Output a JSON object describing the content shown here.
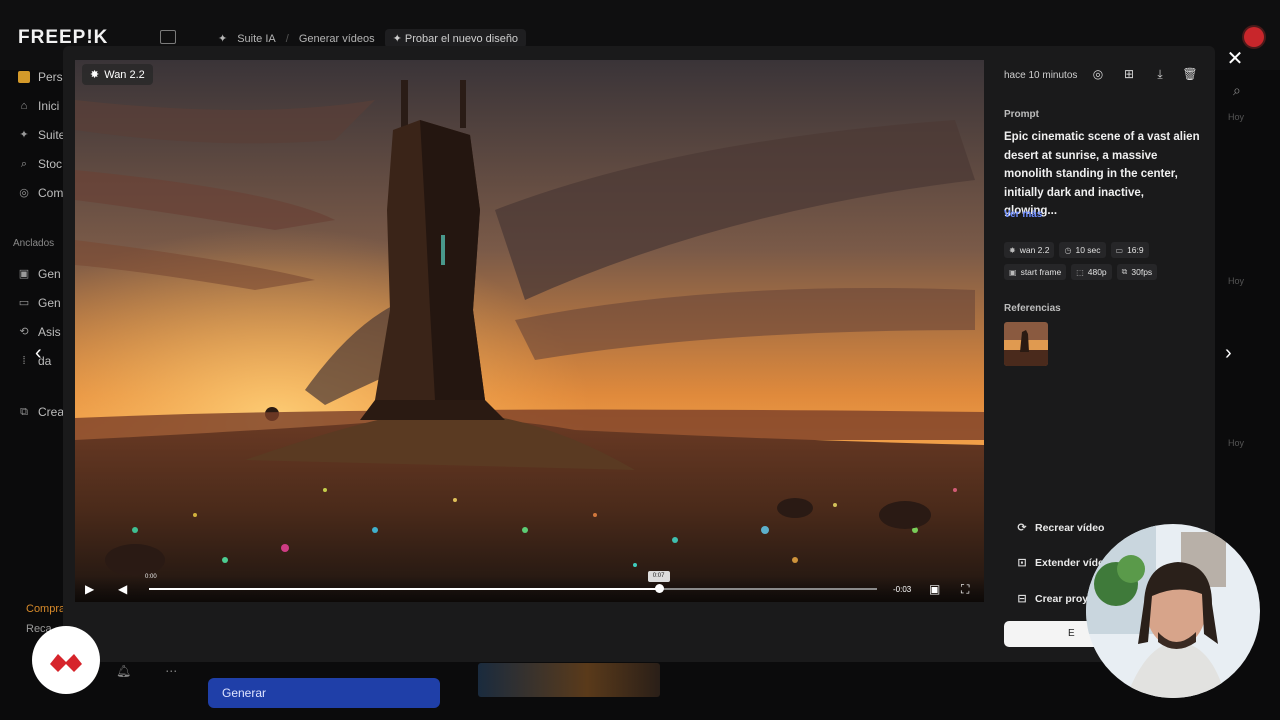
{
  "app": {
    "logo": "FREEP!K",
    "breadcrumbs": [
      "Suite IA",
      "Generar vídeos"
    ],
    "new_design_label": "Probar el nuevo diseño"
  },
  "sidebar": {
    "items": [
      {
        "label": "Pers",
        "icon": "folder-icon"
      },
      {
        "label": "Inici",
        "icon": "home-icon"
      },
      {
        "label": "Suite",
        "icon": "sparkle-icon"
      },
      {
        "label": "Stoc",
        "icon": "search-icon"
      },
      {
        "label": "Com",
        "icon": "globe-icon"
      }
    ],
    "pinned_heading": "Anclados",
    "pinned": [
      {
        "label": "Gen",
        "icon": "image-icon"
      },
      {
        "label": "Gen",
        "icon": "video-icon"
      },
      {
        "label": "Asis",
        "icon": "assistant-icon"
      },
      {
        "label": "da",
        "icon": "grid-icon"
      },
      {
        "label": "Crea",
        "icon": "copy-icon"
      }
    ],
    "buy_label": "Compra",
    "recharge_label": "Reca"
  },
  "background": {
    "generate_label": "Generar",
    "today_label": "Hoy"
  },
  "video": {
    "model_badge": "Wan 2.2",
    "current_time": "0:00",
    "hover_time": "0:07",
    "remaining": "-0:03",
    "progress_fraction": 0.7
  },
  "details": {
    "timestamp": "hace 10 minutos",
    "prompt_heading": "Prompt",
    "prompt_text": "Epic cinematic scene of a vast alien desert at sunrise, a massive monolith standing in the center, initially dark and inactive, glowing...",
    "see_more": "Ver más",
    "tags": [
      {
        "icon": "sparkle-icon",
        "label": "wan 2.2"
      },
      {
        "icon": "clock-icon",
        "label": "10 sec"
      },
      {
        "icon": "aspect-ratio-icon",
        "label": "16:9"
      },
      {
        "icon": "image-icon",
        "label": "start frame"
      },
      {
        "icon": "resolution-icon",
        "label": "480p"
      },
      {
        "icon": "fps-icon",
        "label": "30fps"
      }
    ],
    "references_heading": "Referencias",
    "actions": [
      {
        "icon": "refresh-icon",
        "label": "Recrear vídeo"
      },
      {
        "icon": "extend-icon",
        "label": "Extender víde"
      },
      {
        "icon": "project-icon",
        "label": "Crear proye"
      }
    ],
    "edit_button_label": "E"
  },
  "colors": {
    "accent": "#6d8cff",
    "brand_red": "#d6242b",
    "generate_blue": "#1f3fa8"
  }
}
